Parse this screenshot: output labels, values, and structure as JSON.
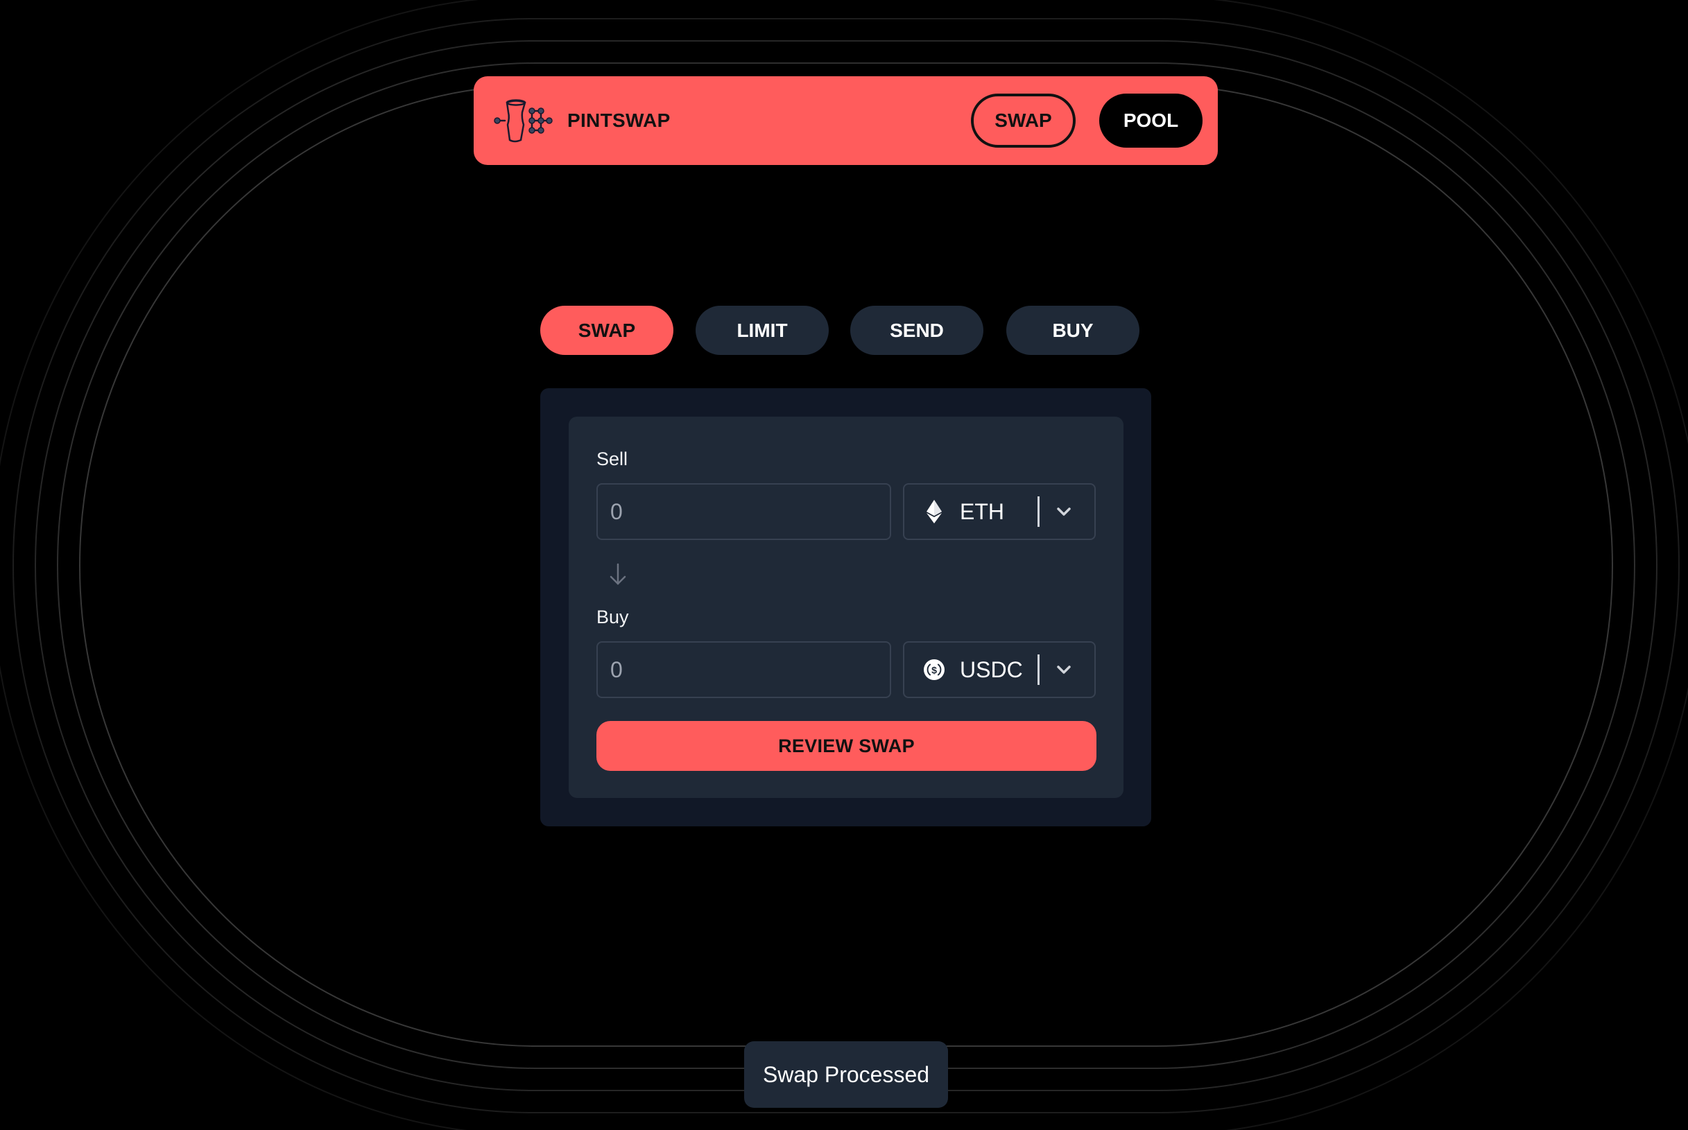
{
  "app": {
    "brand": "PINTSWAP",
    "logo_icon": "pint-glass-network-icon",
    "accent_color": "#FF5C5C"
  },
  "header": {
    "nav": [
      {
        "label": "SWAP",
        "style": "outlined"
      },
      {
        "label": "POOL",
        "style": "filled"
      }
    ]
  },
  "tabs": [
    {
      "label": "SWAP",
      "active": true
    },
    {
      "label": "LIMIT",
      "active": false
    },
    {
      "label": "SEND",
      "active": false
    },
    {
      "label": "BUY",
      "active": false
    }
  ],
  "swap_form": {
    "sell": {
      "label": "Sell",
      "amount_placeholder": "0",
      "amount_value": "",
      "token": {
        "symbol": "ETH",
        "icon": "ethereum-icon"
      }
    },
    "direction_icon": "arrow-down-icon",
    "buy": {
      "label": "Buy",
      "amount_placeholder": "0",
      "amount_value": "",
      "token": {
        "symbol": "USDC",
        "icon": "usdc-icon"
      }
    },
    "submit_label": "REVIEW SWAP"
  },
  "toast": {
    "message": "Swap Processed"
  }
}
